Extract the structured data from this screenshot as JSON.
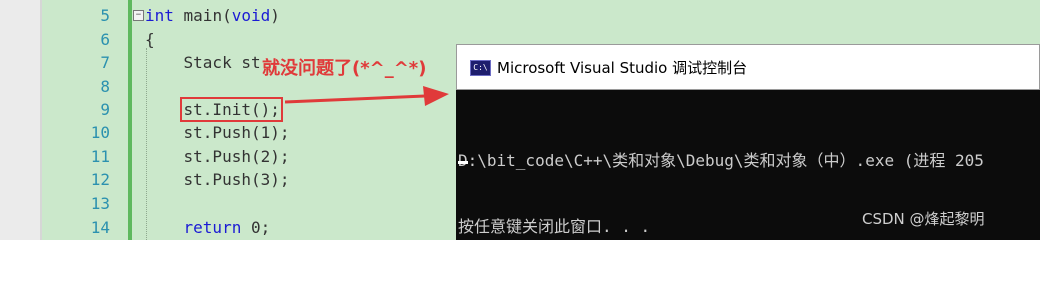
{
  "editor": {
    "lines": [
      {
        "num": "5",
        "code": "int main(void)"
      },
      {
        "num": "6",
        "code": "{"
      },
      {
        "num": "7",
        "code": "    Stack st"
      },
      {
        "num": "8",
        "code": ""
      },
      {
        "num": "9",
        "code": "    st.Init();"
      },
      {
        "num": "10",
        "code": "    st.Push(1);"
      },
      {
        "num": "11",
        "code": "    st.Push(2);"
      },
      {
        "num": "12",
        "code": "    st.Push(3);"
      },
      {
        "num": "13",
        "code": ""
      },
      {
        "num": "14",
        "code": "    return 0;"
      }
    ],
    "fold_glyph": "−"
  },
  "annotation": {
    "text": "就没问题了(*^_^*)",
    "color": "#e03a3a"
  },
  "console": {
    "icon_text": "C:\\",
    "title": "Microsoft Visual Studio 调试控制台",
    "output_line1": "D:\\bit_code\\C++\\类和对象\\Debug\\类和对象（中）.exe (进程 205",
    "output_line2": "按任意键关闭此窗口. . ."
  },
  "watermark": "CSDN @烽起黎明"
}
